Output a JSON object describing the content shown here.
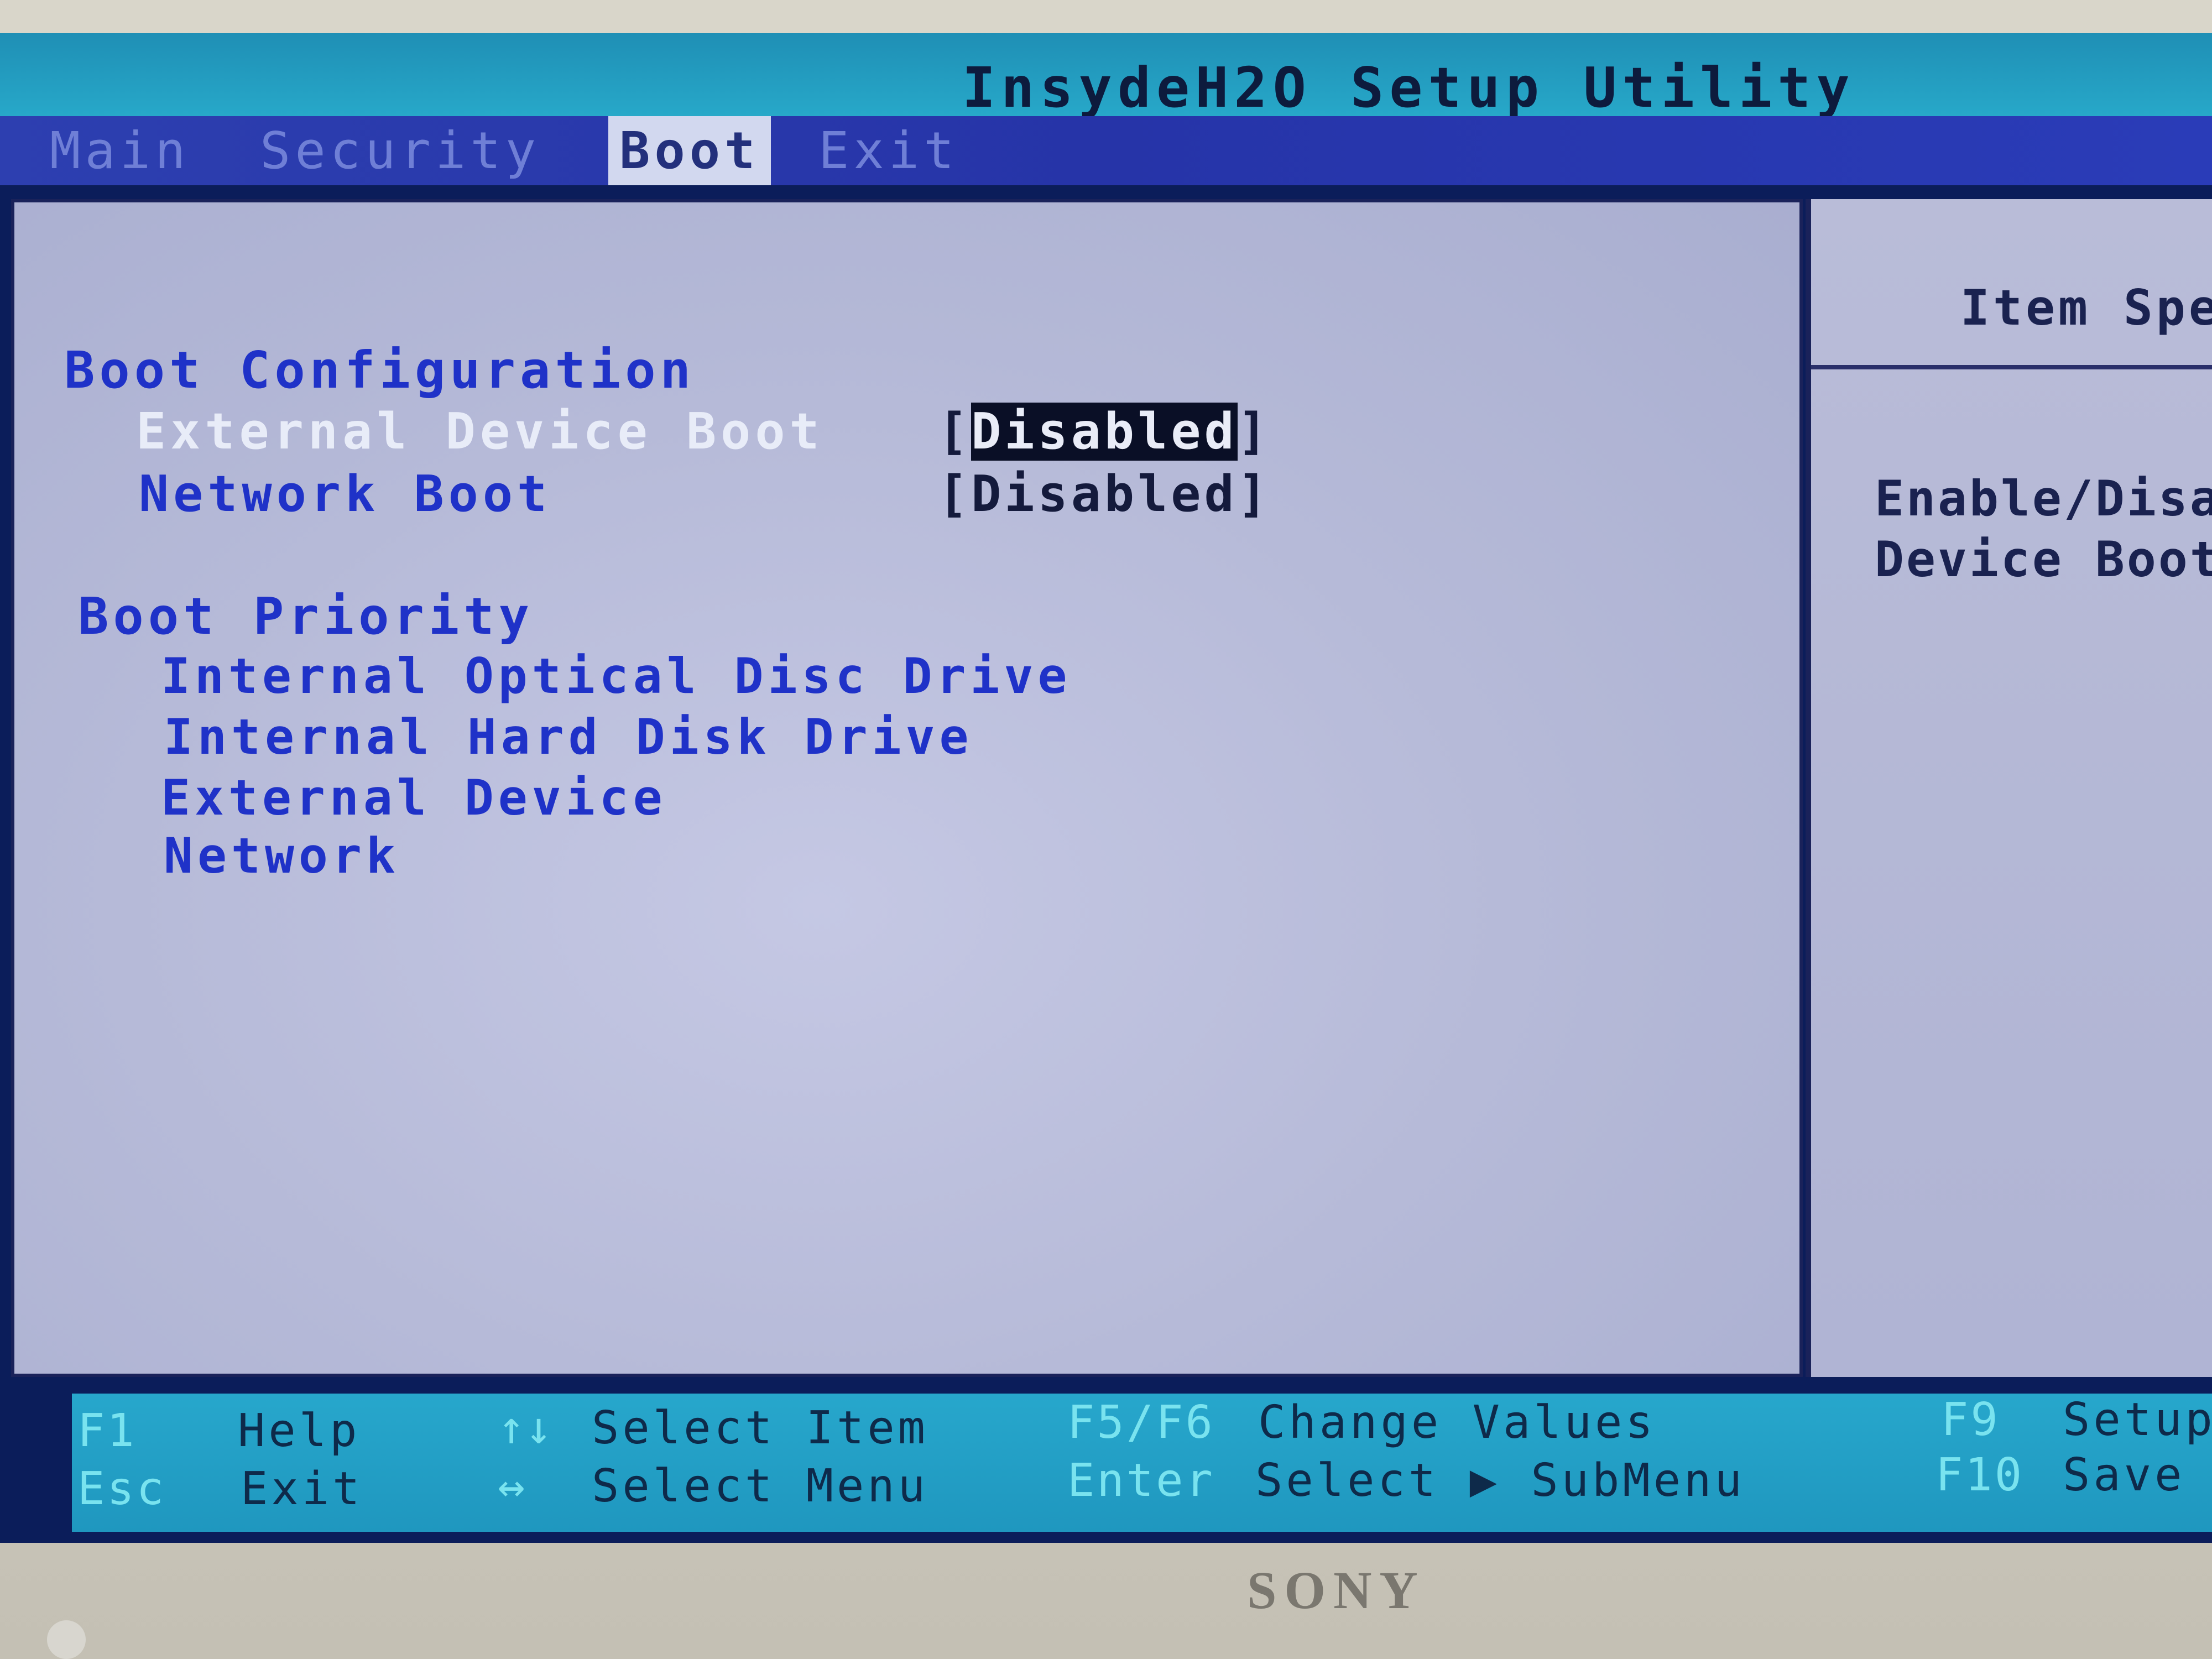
{
  "title": "InsydeH2O Setup Utility",
  "menu": {
    "tabs": [
      {
        "label": "Main",
        "active": false
      },
      {
        "label": "Security",
        "active": false
      },
      {
        "label": "Boot",
        "active": true
      },
      {
        "label": "Exit",
        "active": false
      }
    ]
  },
  "boot_configuration": {
    "heading": "Boot Configuration",
    "options": [
      {
        "label": "External Device Boot",
        "value": "Disabled",
        "selected": true
      },
      {
        "label": "Network Boot",
        "value": "Disabled",
        "selected": false
      }
    ]
  },
  "boot_priority": {
    "heading": "Boot Priority",
    "items": [
      "Internal Optical Disc Drive",
      "Internal Hard Disk Drive",
      "External Device",
      "Network"
    ]
  },
  "help_panel": {
    "title": "Item Spe",
    "lines": [
      "Enable/Disa",
      "Device Boot"
    ]
  },
  "footer": {
    "f1_key": "F1",
    "f1_desc": "Help",
    "esc_key": "Esc",
    "esc_desc": "Exit",
    "updown_arrows": "↑↓",
    "updown_desc": "Select Item",
    "leftright_arrows": "↔",
    "leftright_desc": "Select Menu",
    "f5f6_key": "F5/F6",
    "f5f6_desc": "Change Values",
    "enter_key": "Enter",
    "enter_desc": "Select ▶ SubMenu",
    "f9_key": "F9",
    "f9_desc": "Setup",
    "f10_key": "F10",
    "f10_desc": "Save"
  },
  "brand": "SONY",
  "colors": {
    "title_bar": "#27a8c9",
    "menu_bar": "#2d3fb0",
    "panel_bg": "#b6bad8",
    "heading_blue": "#1f32c8",
    "footer_bg": "#27a7cc"
  }
}
